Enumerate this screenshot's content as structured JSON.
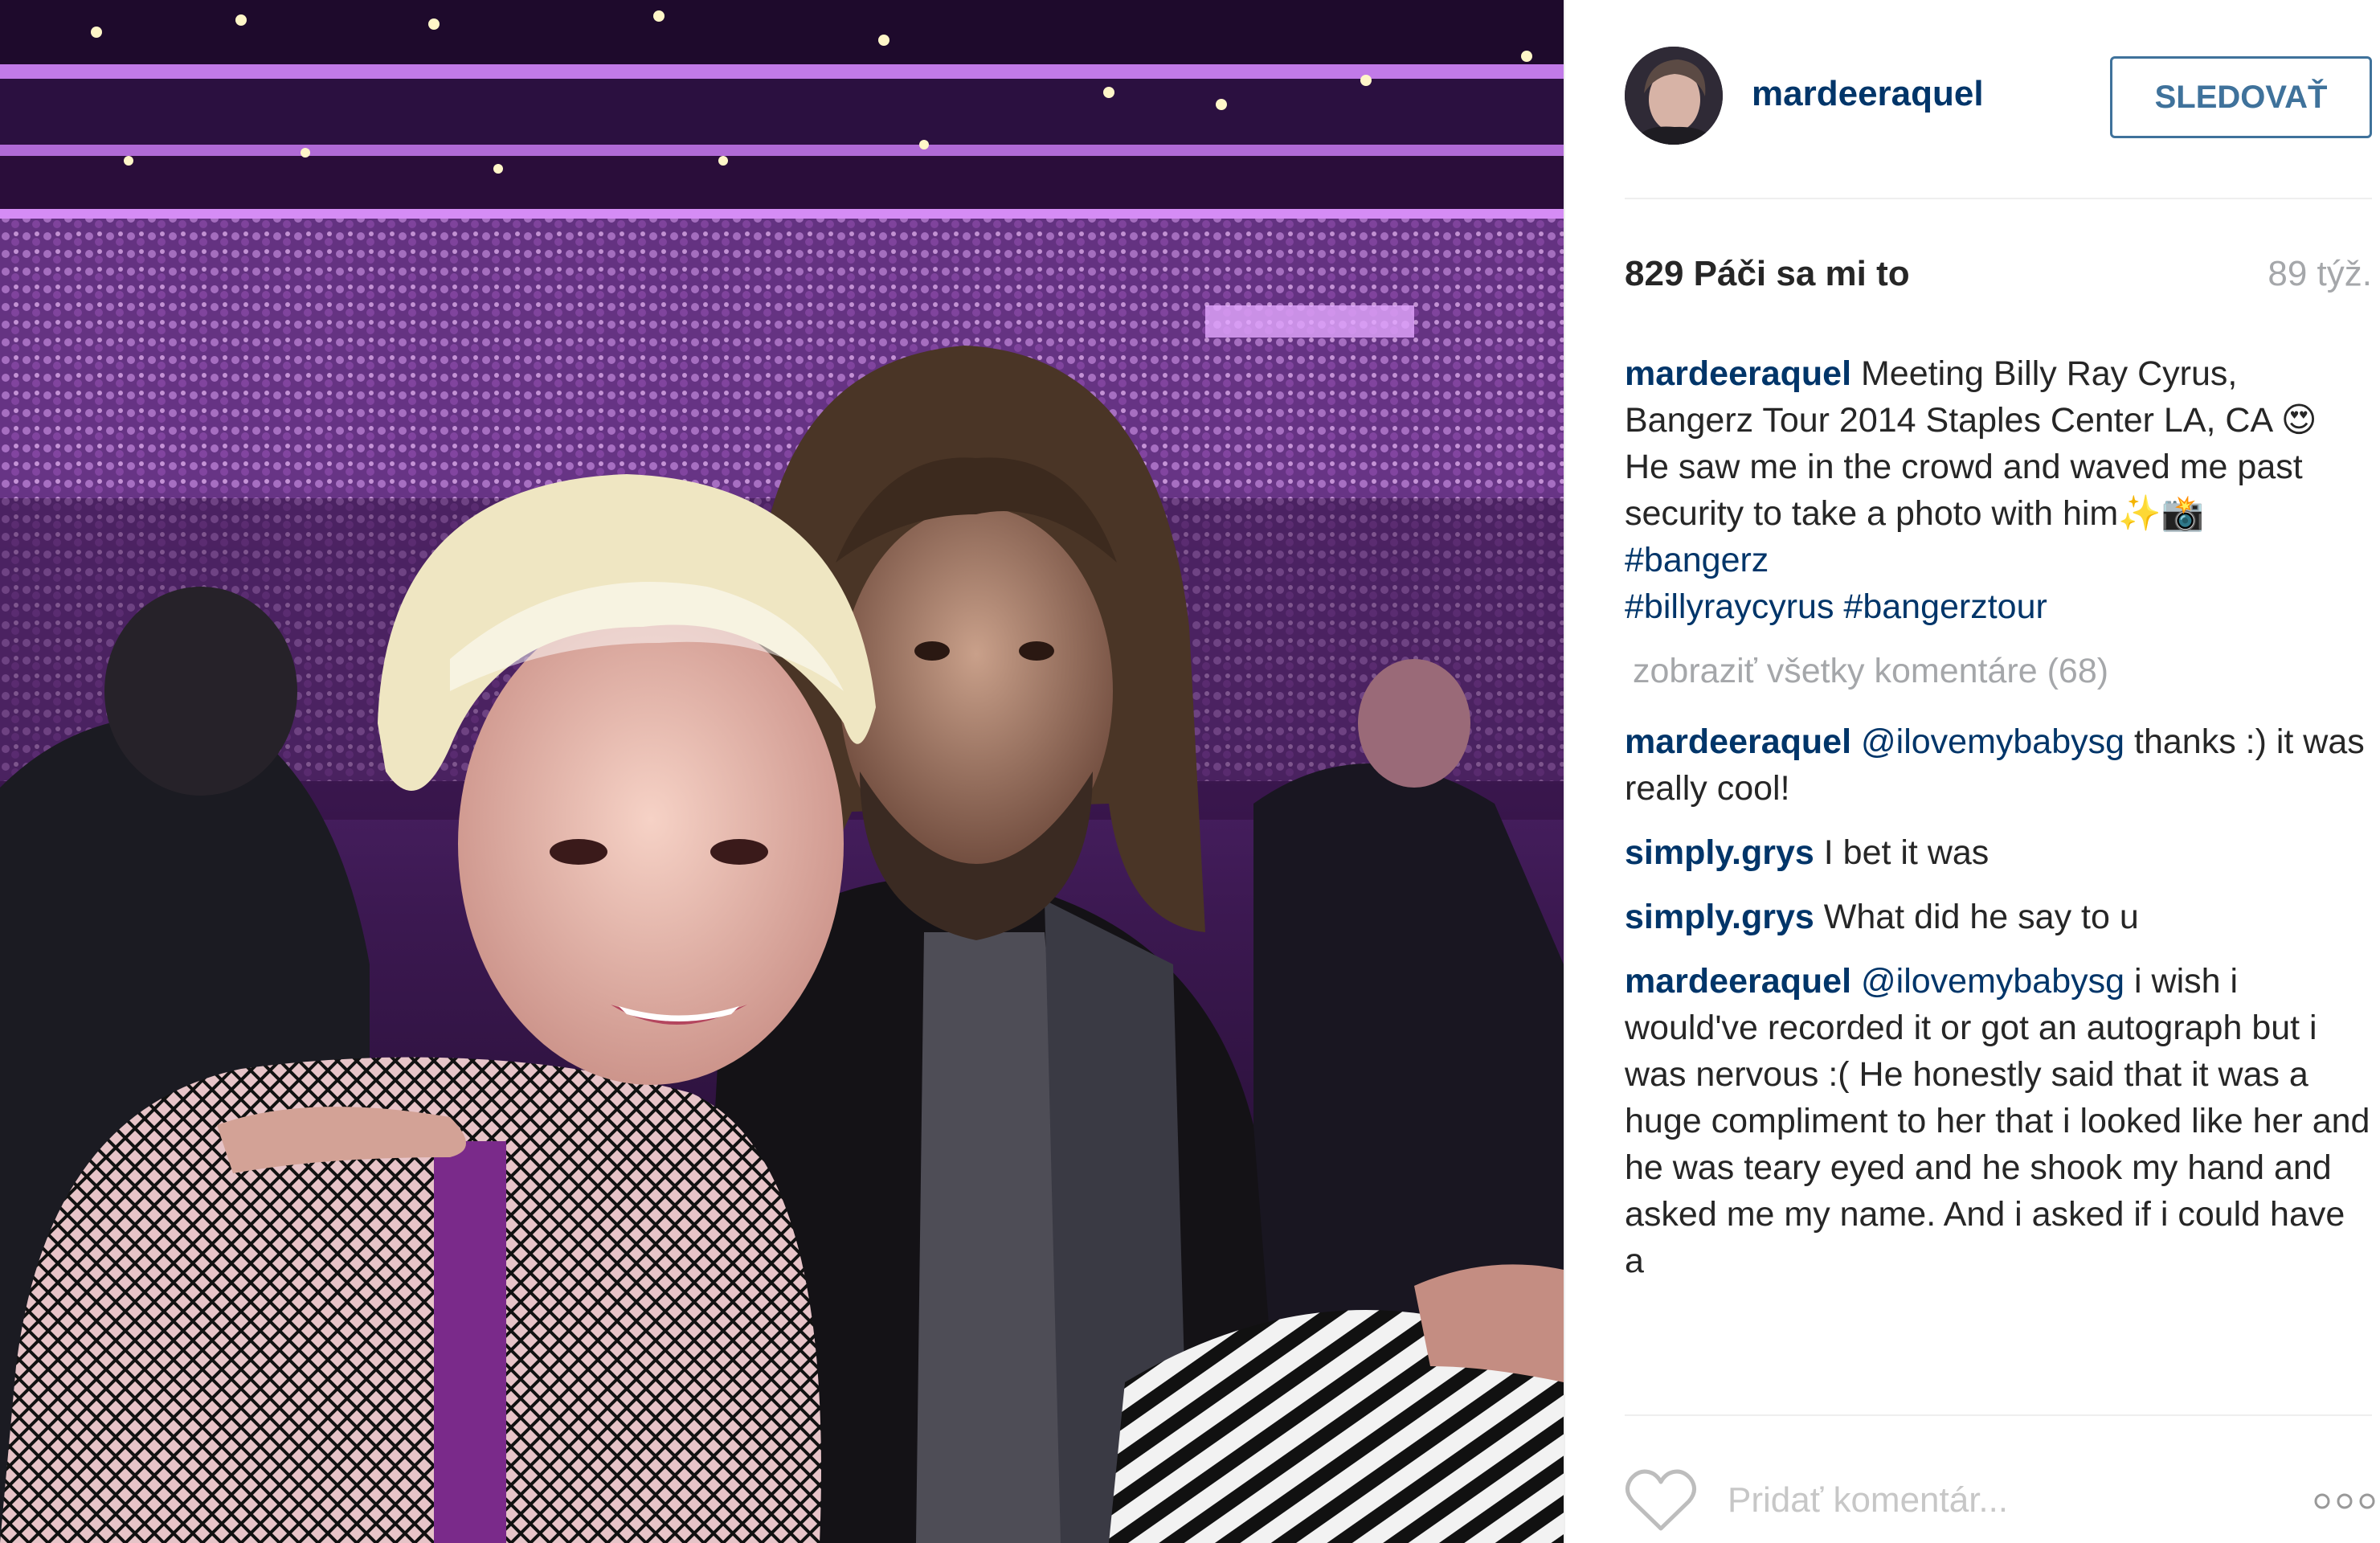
{
  "post": {
    "username": "mardeeraquel",
    "follow_label": "SLEDOVAŤ",
    "likes": "829 Páči sa mi to",
    "time": "89 týž."
  },
  "caption": {
    "username": "mardeeraquel",
    "line1": " Meeting Billy Ray Cyrus, Bangerz Tour 2014 Staples Center LA, CA 😍",
    "line2": "He saw me in the crowd and waved me past security to take a photo with him✨📸",
    "hashtag1": "#bangerz",
    "hashtag2": "#billyraycyrus",
    "hashtag3": "#bangerztour"
  },
  "view_all_comments": "zobraziť všetky komentáre (68)",
  "comments": [
    {
      "user": "mardeeraquel",
      "mention": "@ilovemybabysg",
      "text": " thanks :) it was really cool!"
    },
    {
      "user": "simply.grys",
      "mention": "",
      "text": " I bet it was"
    },
    {
      "user": "simply.grys",
      "mention": "",
      "text": " What did he say to u"
    },
    {
      "user": "mardeeraquel",
      "mention": "@ilovemybabysg",
      "text": " i wish i would've recorded it or got an autograph but i was nervous :( He honestly said that it was a huge compliment to her that i looked like her and he was teary eyed and he shook my hand and asked me my name. And i asked if i could have a"
    }
  ],
  "footer": {
    "comment_placeholder": "Pridať komentár..."
  },
  "icons": {
    "like": "heart-icon",
    "more": "more-options-icon"
  },
  "colors": {
    "link": "#003569",
    "follow": "#3f729b",
    "muted": "#a5a7aa"
  }
}
